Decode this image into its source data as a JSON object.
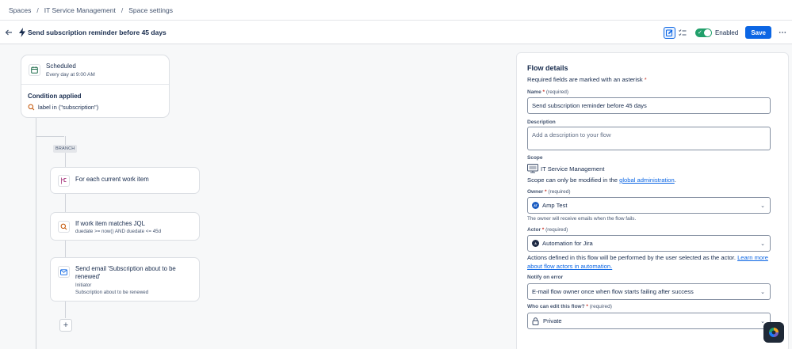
{
  "breadcrumbs": [
    "Spaces",
    "IT Service Management",
    "Space settings"
  ],
  "header": {
    "title": "Send subscription reminder before 45 days",
    "enabled_label": "Enabled",
    "save_label": "Save",
    "more_label": "⋯"
  },
  "trigger": {
    "title": "Scheduled",
    "subtitle": "Every day at 9:00 AM",
    "condition_title": "Condition applied",
    "condition_text": "label in (\"subscription\")"
  },
  "branch_label": "BRANCH",
  "steps": [
    {
      "title": "For each current work item",
      "subtitle": ""
    },
    {
      "title": "If work item matches JQL",
      "subtitle": "duedate >= now() AND duedate <= 45d"
    },
    {
      "title": "Send email 'Subscription about to be renewed'",
      "subtitle1": "Initiator",
      "subtitle2": "Subscription about to be renewed"
    }
  ],
  "add_label": "+",
  "panel": {
    "heading": "Flow details",
    "required_note": "Required fields are marked with an asterisk",
    "asterisk": "*",
    "name_label": "Name",
    "required_text": "(required)",
    "name_value": "Send subscription reminder before 45 days",
    "description_label": "Description",
    "description_placeholder": "Add a description to your flow",
    "scope_label": "Scope",
    "scope_value": "IT Service Management",
    "scope_note_pre": "Scope can only be modified in the ",
    "scope_note_link": "global administration",
    "scope_note_post": ".",
    "owner_label": "Owner",
    "owner_value": "Amp Test",
    "owner_initials": "AT",
    "owner_hint": "The owner will receive emails when the flow fails.",
    "actor_label": "Actor",
    "actor_value": "Automation for Jira",
    "actor_initials": "A",
    "actor_note_pre": "Actions defined in this flow will be performed by the user selected as the actor. ",
    "actor_note_link": "Learn more about flow actors in automation.",
    "notify_label": "Notify on error",
    "notify_value": "E-mail flow owner once when flow starts failing after success",
    "who_label": "Who can edit this flow?",
    "who_value": "Private"
  },
  "colors": {
    "accent": "#0c66e4",
    "success": "#22a06b",
    "required": "#c9372c"
  }
}
